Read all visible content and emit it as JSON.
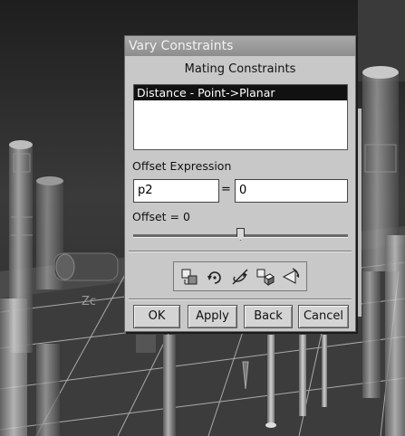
{
  "dialog": {
    "title": "Vary Constraints",
    "section_title": "Mating Constraints",
    "constraints": [
      "Distance - Point->Planar"
    ],
    "offset_expression_label": "Offset Expression",
    "expression_name": "p2",
    "equals": "=",
    "expression_value": "0",
    "offset_readout": "Offset = 0",
    "slider_value": 0.5,
    "toolbar_icons": [
      "move-component-icon",
      "rotate-icon",
      "free-rotate-icon",
      "snap-component-icon",
      "reorient-icon"
    ],
    "buttons": {
      "ok": "OK",
      "apply": "Apply",
      "back": "Back",
      "cancel": "Cancel"
    }
  },
  "viewport": {
    "axis_label": "Zc"
  }
}
